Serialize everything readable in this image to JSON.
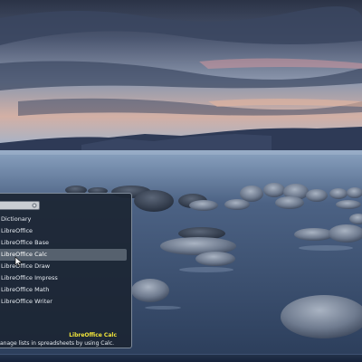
{
  "search": {
    "value": "",
    "icon": "clear-search-icon"
  },
  "menu": {
    "items": [
      {
        "label": "Dictionary"
      },
      {
        "label": "LibreOffice"
      },
      {
        "label": "LibreOffice Base"
      },
      {
        "label": "LibreOffice Calc"
      },
      {
        "label": "LibreOffice Draw"
      },
      {
        "label": "LibreOffice Impress"
      },
      {
        "label": "LibreOffice Math"
      },
      {
        "label": "LibreOffice Writer"
      }
    ],
    "selected_index": 3
  },
  "selected_app": {
    "title": "LibreOffice Calc",
    "description": "anage lists in spreadsheets by using Calc."
  },
  "colors": {
    "title_accent": "#f2e53a",
    "menu_background": "#1c2634",
    "selection": "#56616e"
  }
}
